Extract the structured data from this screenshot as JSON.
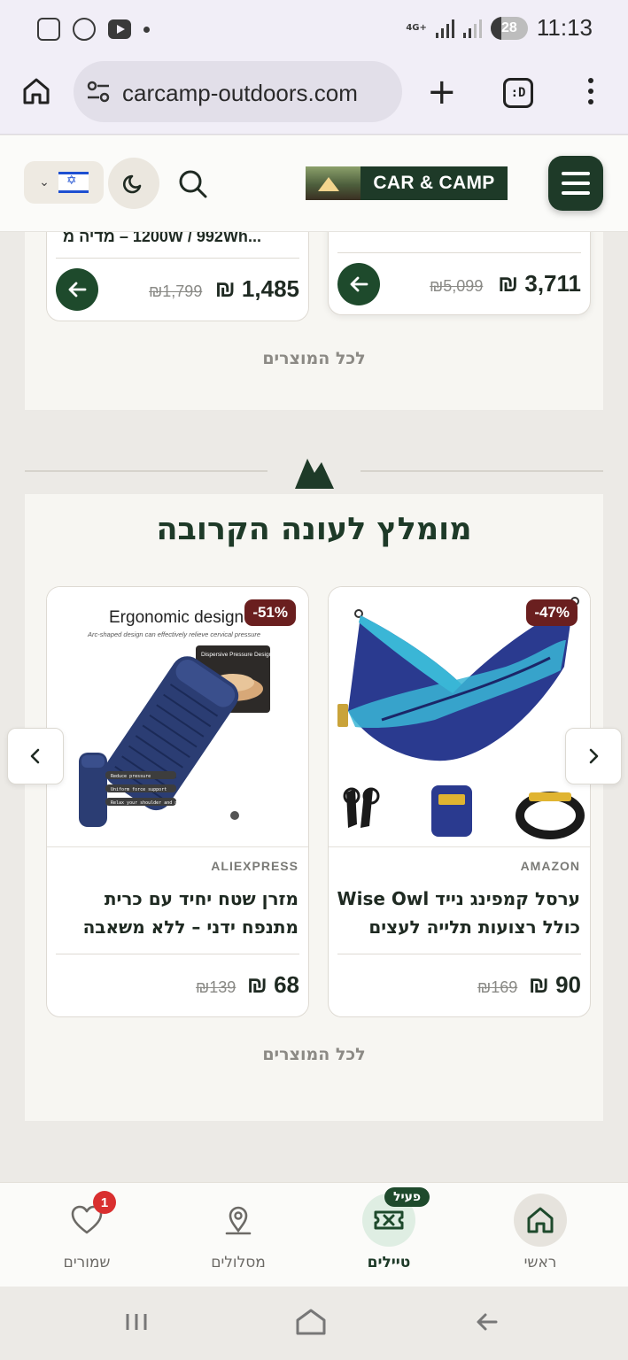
{
  "status_bar": {
    "network": "4G+",
    "battery": "28",
    "time": "11:13"
  },
  "browser": {
    "url": "carcamp-outdoors.com",
    "tabs_label": ":D"
  },
  "site_header": {
    "logo_text": "CAR & CAMP",
    "language": "Hebrew (Israel flag)"
  },
  "prev_products": [
    {
      "truncated_title": "...1200W / 992Wh – מדיה מ",
      "price": "1,485 ₪",
      "old_price": "₪1,799"
    },
    {
      "price": "3,711 ₪",
      "old_price": "₪5,099"
    }
  ],
  "all_products_label": "לכל המוצרים",
  "section": {
    "title": "מומלץ לעונה הקרובה",
    "products": [
      {
        "discount": "-47%",
        "store": "AMAZON",
        "title": "ערסל קמפינג נייד Wise Owl כולל רצועות תלייה לעצים",
        "price": "90 ₪",
        "old_price": "₪169"
      },
      {
        "discount": "-51%",
        "store": "ALIEXPRESS",
        "title": "מזרן שטח יחיד עם כרית מתנפח ידני – ללא משאבה",
        "price": "68 ₪",
        "old_price": "₪139",
        "image_text": {
          "headline": "Ergonomic design",
          "subline": "Arc-shaped design can effectively relieve cervical pressure",
          "callout": "Dispersive Pressure Design",
          "bullets": [
            "Reduce pressure",
            "Uniform force support",
            "Relax your shoulder and neck"
          ]
        }
      }
    ]
  },
  "bottom_nav": {
    "active_badge": "פעיל",
    "saved_count": "1",
    "items": [
      {
        "label": "ראשי"
      },
      {
        "label": "טיילים"
      },
      {
        "label": "מסלולים"
      },
      {
        "label": "שמורים"
      }
    ]
  },
  "colors": {
    "brand_green": "#1e3a28",
    "badge_red": "#6a1f1f",
    "notification_red": "#d92f2f"
  }
}
